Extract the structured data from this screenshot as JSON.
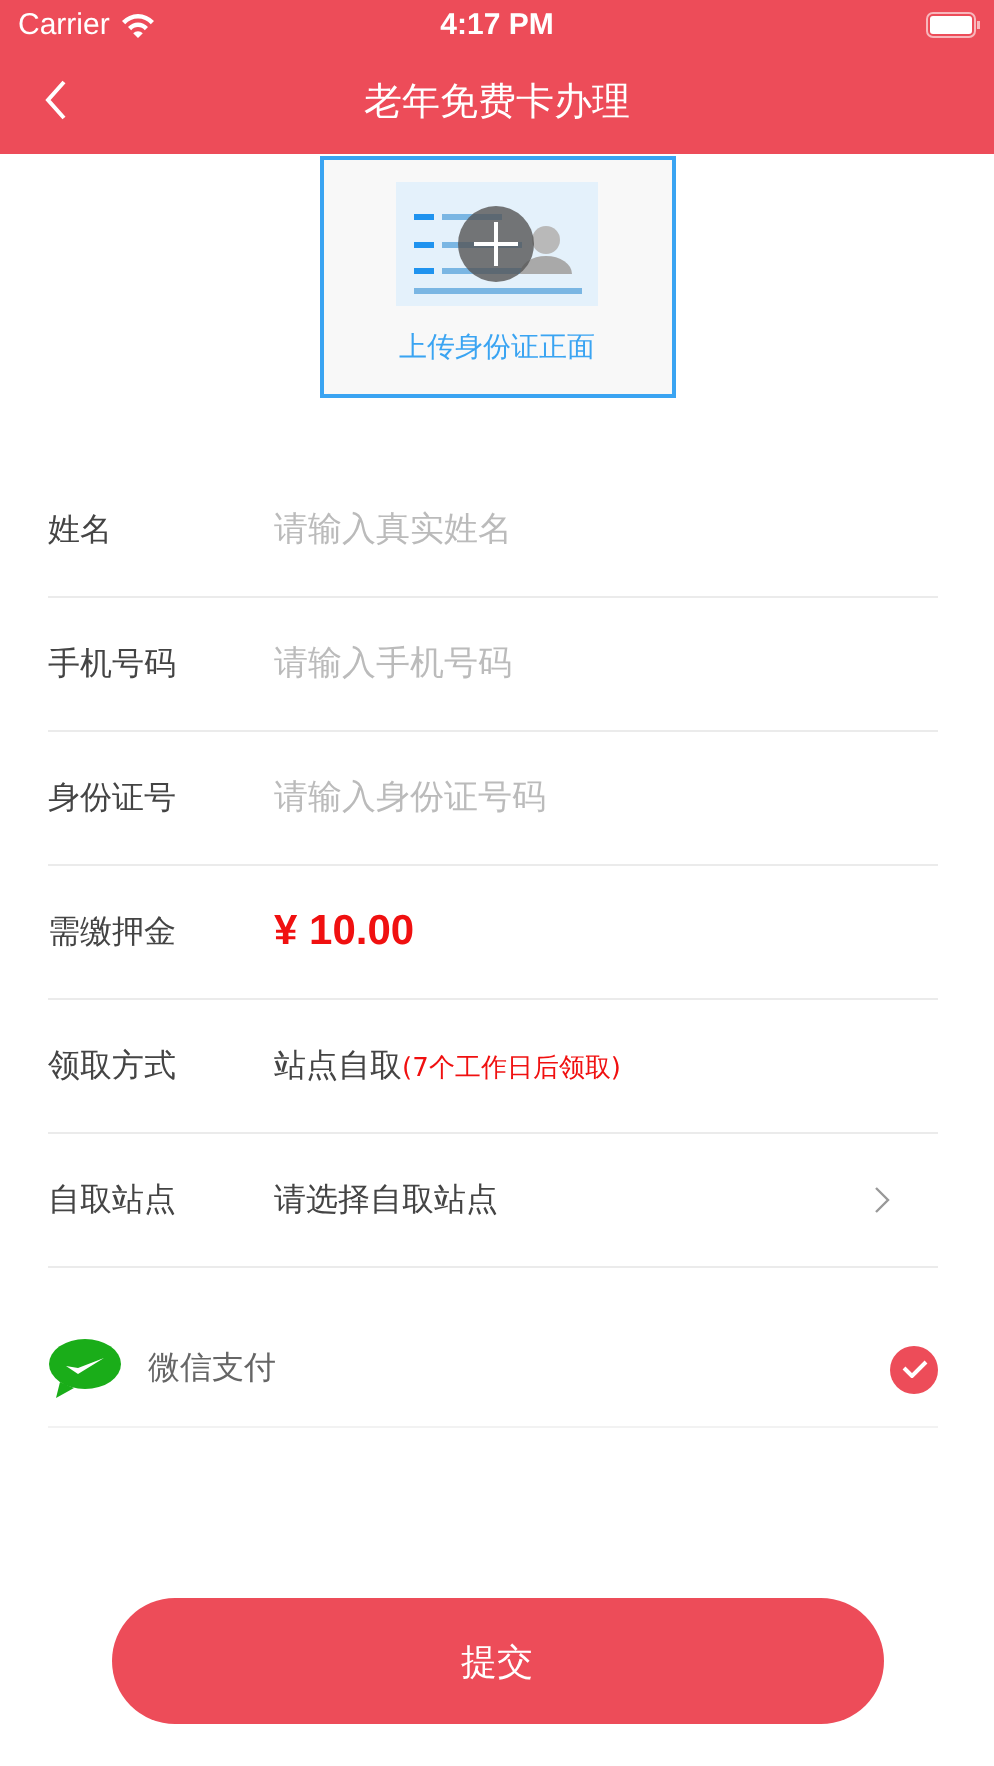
{
  "status_bar": {
    "carrier": "Carrier",
    "time": "4:17 PM"
  },
  "nav": {
    "title": "老年免费卡办理"
  },
  "upload": {
    "label": "上传身份证正面"
  },
  "rows": [
    {
      "kind": "input",
      "label": "姓名",
      "placeholder": "请输入真实姓名"
    },
    {
      "kind": "input",
      "label": "手机号码",
      "placeholder": "请输入手机号码"
    },
    {
      "kind": "input",
      "label": "身份证号",
      "placeholder": "请输入身份证号码"
    },
    {
      "kind": "price",
      "label": "需缴押金",
      "value": "¥ 10.00"
    },
    {
      "kind": "text",
      "label": "领取方式",
      "value": "站点自取",
      "note": "(7个工作日后领取)"
    },
    {
      "kind": "select",
      "label": "自取站点",
      "value": "请选择自取站点"
    }
  ],
  "payment": {
    "label": "微信支付",
    "selected": true
  },
  "submit": "提交"
}
